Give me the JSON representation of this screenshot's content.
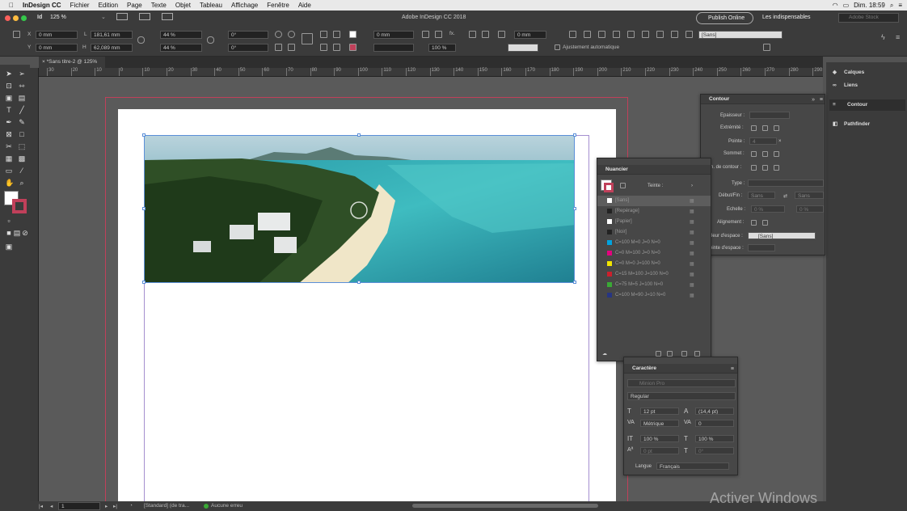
{
  "menubar": {
    "app": "InDesign CC",
    "items": [
      "Fichier",
      "Edition",
      "Page",
      "Texte",
      "Objet",
      "Tableau",
      "Affichage",
      "Fenêtre",
      "Aide"
    ],
    "clock": "Dim. 18:59"
  },
  "titlebar": {
    "zoom": "125 %",
    "title": "Adobe InDesign CC 2018",
    "publish": "Publish Online",
    "workspace": "Les indispensables",
    "search_placeholder": "Adobe Stock"
  },
  "control": {
    "x_label": "X",
    "x_value": "0 mm",
    "y_label": "Y",
    "y_value": "0 mm",
    "w_label": "L",
    "w_value": "181,61 mm",
    "h_label": "H",
    "h_value": "62,089 mm",
    "scale_x": "44 %",
    "scale_y": "44 %",
    "rotate": "0°",
    "shear": "0°",
    "stroke_w": "0 mm",
    "opacity": "100 %",
    "autofit": "Ajustement automatique",
    "object_style": "[Sans]"
  },
  "tab": {
    "label": "*Sans titre-2 @ 125%"
  },
  "ruler_ticks": [
    "30",
    "20",
    "10",
    "0",
    "10",
    "20",
    "30",
    "40",
    "50",
    "60",
    "70",
    "80",
    "90",
    "100",
    "110",
    "120",
    "130",
    "140",
    "150",
    "160",
    "170",
    "180",
    "190",
    "200",
    "210",
    "220",
    "230",
    "240",
    "250",
    "260",
    "270",
    "280",
    "290"
  ],
  "status": {
    "page": "1",
    "profile": "[Standard] (de tra...",
    "errors": "Aucune erreu"
  },
  "dock": {
    "items": [
      "Calques",
      "Liens",
      "Contour",
      "Pathfinder"
    ]
  },
  "contour": {
    "title": "Contour",
    "epaisseur": "Epaisseur :",
    "extremite": "Extrémité :",
    "pointe": "Pointe :",
    "pointe_val": "4",
    "sommet": "Sommet :",
    "align": "Align. de contour :",
    "type": "Type :",
    "debut_fin": "Début/Fin :",
    "debut_val": "Sans",
    "fin_val": "Sans",
    "echelle": "Echelle :",
    "echelle_1": "0 %",
    "echelle_2": "0 %",
    "alignement": "Alignement :",
    "couleur_espace": "Couleur d'espace :",
    "couleur_val": "[Sans]",
    "teinte_espace": "Teinte d'espace :"
  },
  "nuancier": {
    "title": "Nuancier",
    "teinte": "Teinte :",
    "swatches": [
      {
        "name": "[Sans]",
        "color": "#ffffff"
      },
      {
        "name": "[Repérage]",
        "color": "#222222"
      },
      {
        "name": "[Papier]",
        "color": "#ffffff"
      },
      {
        "name": "[Noir]",
        "color": "#222222"
      },
      {
        "name": "C=100 M=0 J=0 N=0",
        "color": "#00a3df"
      },
      {
        "name": "C=0 M=100 J=0 N=0",
        "color": "#e4007f"
      },
      {
        "name": "C=0 M=0 J=100 N=0",
        "color": "#f2e500"
      },
      {
        "name": "C=15 M=100 J=100 N=0",
        "color": "#cc1f2c"
      },
      {
        "name": "C=75 M=5 J=100 N=0",
        "color": "#3aa935"
      },
      {
        "name": "C=100 M=90 J=10 N=0",
        "color": "#273582"
      }
    ]
  },
  "caractere": {
    "title": "Caractère",
    "font": "Minion Pro",
    "style": "Regular",
    "size": "12 pt",
    "leading": "(14,4 pt)",
    "kerning": "Métrique",
    "tracking": "0",
    "vscale": "100 %",
    "hscale": "100 %",
    "baseline": "0 pt",
    "skew": "0°",
    "langue_label": "Langue",
    "langue": "Français"
  },
  "watermark": "Activer Windows"
}
